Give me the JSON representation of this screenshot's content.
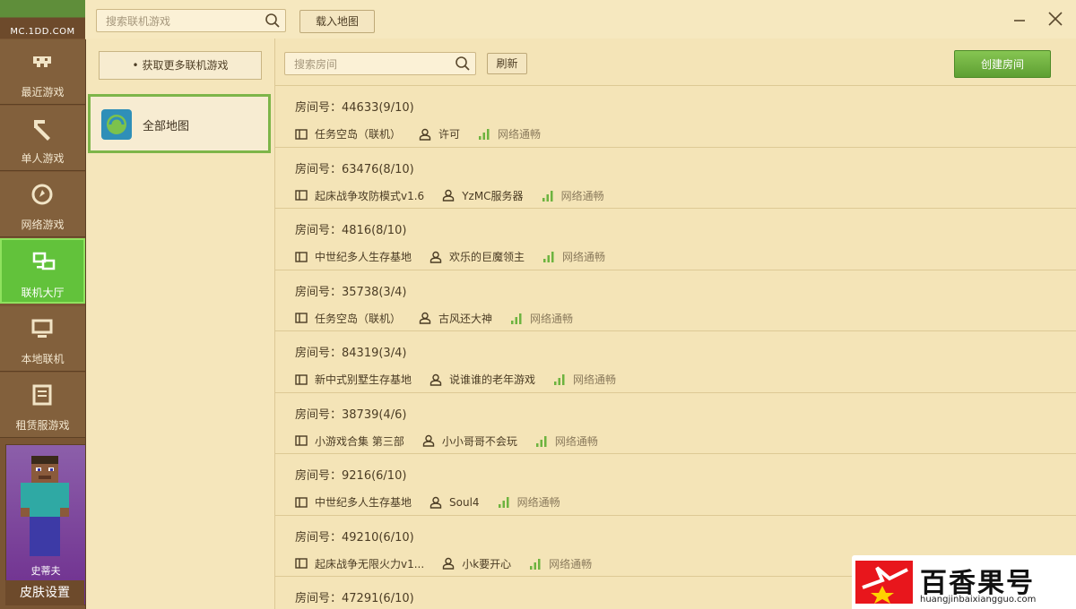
{
  "sidebar": {
    "logo_text": "MC.1DD.COM",
    "items": [
      {
        "label": "最近游戏",
        "icon": "gamepad-icon"
      },
      {
        "label": "单人游戏",
        "icon": "pickaxe-icon"
      },
      {
        "label": "网络游戏",
        "icon": "compass-icon"
      },
      {
        "label": "联机大厅",
        "icon": "network-icon",
        "active": true
      },
      {
        "label": "本地联机",
        "icon": "monitor-icon"
      },
      {
        "label": "租赁服游戏",
        "icon": "server-icon"
      }
    ],
    "skin": {
      "player_name": "史蒂夫",
      "button_label": "皮肤设置"
    }
  },
  "topbar": {
    "search_placeholder": "搜索联机游戏",
    "load_map_label": "载入地图"
  },
  "maps": {
    "more_games_label": "• 获取更多联机游戏",
    "all_maps_label": "全部地图"
  },
  "rooms_panel": {
    "search_placeholder": "搜索房间",
    "refresh_label": "刷新",
    "create_room_label": "创建房间",
    "rooms": [
      {
        "id": "房间号：44633(9/10)",
        "map": "任务空岛（联机）",
        "owner": "许可",
        "network": "网络通畅"
      },
      {
        "id": "房间号：63476(8/10)",
        "map": "起床战争攻防模式v1.6",
        "owner": "YzMC服务器",
        "network": "网络通畅"
      },
      {
        "id": "房间号：4816(8/10)",
        "map": "中世纪多人生存基地",
        "owner": "欢乐的巨魔领主",
        "network": "网络通畅"
      },
      {
        "id": "房间号：35738(3/4)",
        "map": "任务空岛（联机）",
        "owner": "古风还大神",
        "network": "网络通畅"
      },
      {
        "id": "房间号：84319(3/4)",
        "map": "新中式别墅生存基地",
        "owner": "说谁谁的老年游戏",
        "network": "网络通畅"
      },
      {
        "id": "房间号：38739(4/6)",
        "map": "小游戏合集 第三部",
        "owner": "小小哥哥不会玩",
        "network": "网络通畅"
      },
      {
        "id": "房间号：9216(6/10)",
        "map": "中世纪多人生存基地",
        "owner": "Soul4",
        "network": "网络通畅"
      },
      {
        "id": "房间号：49210(6/10)",
        "map": "起床战争无限火力v1...",
        "owner": "小k要开心",
        "network": "网络通畅"
      },
      {
        "id": "房间号：47291(6/10)",
        "map": "",
        "owner": "",
        "network": ""
      }
    ]
  },
  "watermark": {
    "brand": "百香果号",
    "url": "huangjinbaixiangguo.com"
  }
}
